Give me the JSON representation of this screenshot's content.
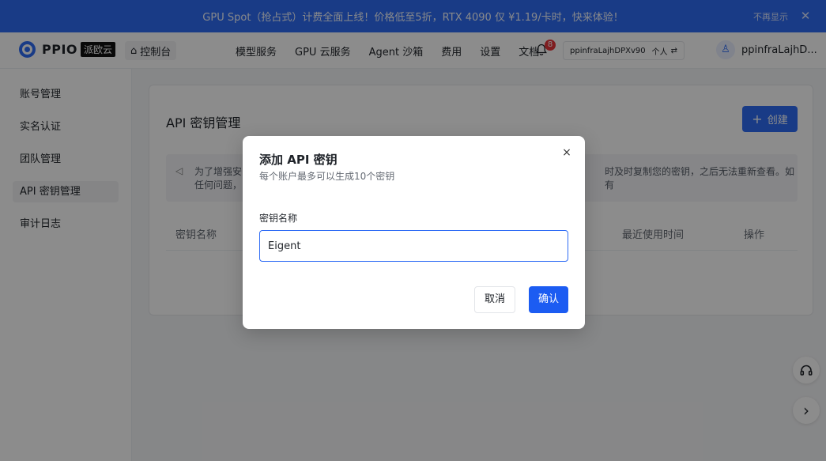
{
  "banner": {
    "text": "GPU Spot（抢占式）计费全面上线！价格低至5折，RTX 4090 仅 ¥1.19/卡时，快来体验！",
    "dismiss_label": "不再显示",
    "close_icon": "✕"
  },
  "navbar": {
    "logo_text": "PPIO",
    "logo_badge": "派欧云",
    "console_label": "控制台",
    "console_icon": "⌂",
    "links": [
      "模型服务",
      "GPU 云服务",
      "Agent 沙箱",
      "费用",
      "设置",
      "文档"
    ],
    "bell_icon": "♫",
    "notification_count": "8",
    "account_id": "ppinfraLajhDPXv90",
    "account_type": "个人",
    "swap_icon": "⇄",
    "user_icon": "♙",
    "user_name": "ppinfraLajhD..."
  },
  "sidebar": {
    "items": [
      "账号管理",
      "实名认证",
      "团队管理",
      "API 密钥管理",
      "审计日志"
    ],
    "active_index": 3
  },
  "main": {
    "title": "API 密钥管理",
    "create_label": "创建",
    "create_icon": "+",
    "notice_icon": "◁",
    "notice_left_line1": "为了增强安",
    "notice_left_line2": "任何问题，",
    "notice_right": "时及时复制您的密钥，之后无法重新查看。如有",
    "columns": {
      "name": "密钥名称",
      "last_used": "最近使用时间",
      "actions": "操作"
    }
  },
  "floating": {
    "support_icon": "☊",
    "next_icon": "›"
  },
  "modal": {
    "title": "添加 API 密钥",
    "subtitle": "每个账户最多可以生成10个密钥",
    "close_icon": "×",
    "field_label": "密钥名称",
    "field_value": "Eigent",
    "cancel_label": "取消",
    "confirm_label": "确认"
  },
  "colors": {
    "accent": "#2f6cf5",
    "confirm": "#1c5cf2",
    "badge": "#e8363b"
  }
}
